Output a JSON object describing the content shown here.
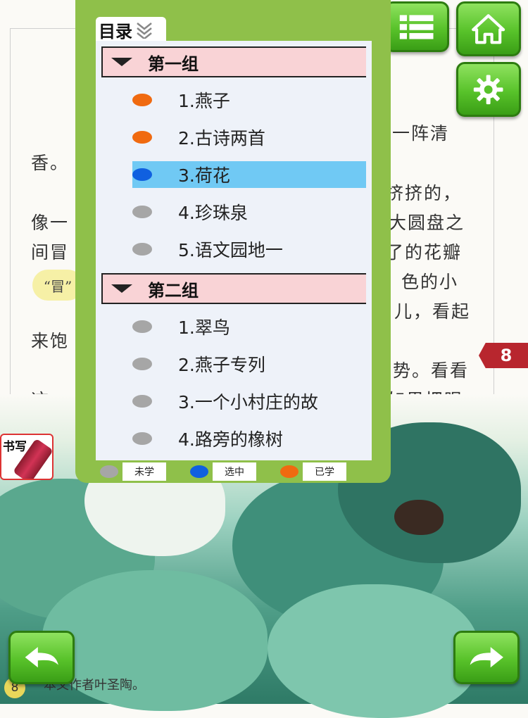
{
  "background_page": {
    "lines": [
      {
        "text": "门一阵清"
      },
      {
        "text": "香。"
      },
      {
        "text": "挤挤的，"
      },
      {
        "text": "像一"
      },
      {
        "text": "大圆盘之"
      },
      {
        "text": "间冒"
      },
      {
        "text": "了的花瓣"
      },
      {
        "text": "色的小"
      },
      {
        "text": "儿，看起"
      },
      {
        "text": "来饱"
      },
      {
        "text": "势。看看"
      },
      {
        "text": "这一"
      },
      {
        "text": "如果把眼"
      }
    ],
    "bubble_text": "“冒”",
    "page_badge": "8",
    "footer_page_number": "8",
    "footer_note": "本文作者叶圣陶。"
  },
  "toc": {
    "title": "目录",
    "groups": [
      {
        "label": "第一组",
        "items": [
          {
            "label": "1.燕子",
            "status": "learned"
          },
          {
            "label": "2.古诗两首",
            "status": "learned"
          },
          {
            "label": "3.荷花",
            "status": "selected"
          },
          {
            "label": "4.珍珠泉",
            "status": "unlearned"
          },
          {
            "label": "5.语文园地一",
            "status": "unlearned"
          }
        ]
      },
      {
        "label": "第二组",
        "items": [
          {
            "label": "1.翠鸟",
            "status": "unlearned"
          },
          {
            "label": "2.燕子专列",
            "status": "unlearned"
          },
          {
            "label": "3.一个小村庄的故",
            "status": "unlearned"
          },
          {
            "label": "4.路旁的橡树",
            "status": "unlearned"
          }
        ]
      }
    ],
    "legend": [
      {
        "label": "未学",
        "color": "#a6a6a6"
      },
      {
        "label": "选中",
        "color": "#1060e0"
      },
      {
        "label": "已学",
        "color": "#f06a10"
      }
    ]
  },
  "status_colors": {
    "learned": "#f06a10",
    "selected": "#1060e0",
    "unlearned": "#a6a6a6"
  },
  "buttons": {
    "menu": "list-icon",
    "home": "home-icon",
    "settings": "gear-icon",
    "back": "back-arrow-icon",
    "forward": "forward-arrow-icon",
    "write_label": "书写"
  },
  "colors": {
    "panel_green": "#8fc04a",
    "button_green": "#58c22a",
    "group_header_bg": "#f9d3d6",
    "selected_row": "#70c9f4",
    "badge_red": "#b8262e"
  }
}
